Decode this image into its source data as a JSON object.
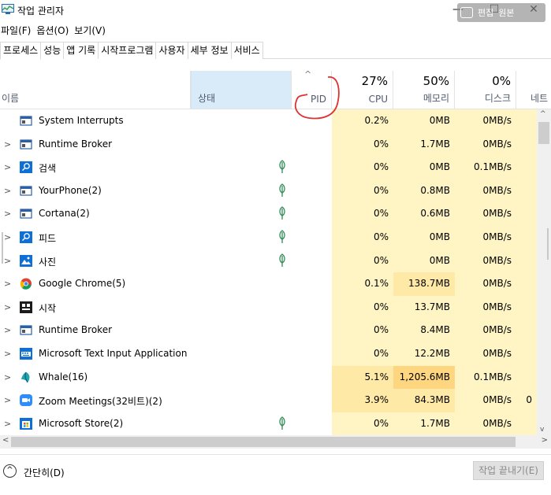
{
  "window": {
    "title": "작업 관리자"
  },
  "overlay": {
    "label_1": "편집",
    "label_2": "원본"
  },
  "menu": [
    "파일(F)",
    "옵션(O)",
    "보기(V)"
  ],
  "tabs": [
    "프로세스",
    "성능",
    "앱 기록",
    "시작프로그램",
    "사용자",
    "세부 정보",
    "서비스"
  ],
  "header": {
    "name": "이름",
    "status": "상태",
    "pid": "PID",
    "cpu": {
      "pct": "27%",
      "label": "CPU"
    },
    "memory": {
      "pct": "50%",
      "label": "메모리"
    },
    "disk": {
      "pct": "0%",
      "label": "디스크"
    },
    "network": {
      "label": "네트"
    }
  },
  "heat_colors": {
    "light": "#fff4c4",
    "medium": "#ffe9a6",
    "strong": "#ffd680"
  },
  "processes": [
    {
      "name": "System Interrupts",
      "icon": "window-icon",
      "expand": false,
      "leaf": false,
      "cpu": "0.2%",
      "mem": "0MB",
      "disk": "0MB/s",
      "net": ""
    },
    {
      "name": "Runtime Broker",
      "icon": "window-icon",
      "expand": true,
      "leaf": false,
      "cpu": "0%",
      "mem": "1.7MB",
      "disk": "0MB/s",
      "net": ""
    },
    {
      "name": "검색",
      "icon": "search-icon",
      "expand": true,
      "leaf": true,
      "cpu": "0%",
      "mem": "0MB",
      "disk": "0.1MB/s",
      "net": ""
    },
    {
      "name": "YourPhone(2)",
      "icon": "window-icon",
      "expand": true,
      "leaf": true,
      "cpu": "0%",
      "mem": "0.8MB",
      "disk": "0MB/s",
      "net": ""
    },
    {
      "name": "Cortana(2)",
      "icon": "window-icon",
      "expand": true,
      "leaf": true,
      "cpu": "0%",
      "mem": "0.6MB",
      "disk": "0MB/s",
      "net": ""
    },
    {
      "name": "피드",
      "icon": "search-icon",
      "expand": true,
      "leaf": true,
      "cpu": "0%",
      "mem": "0MB",
      "disk": "0MB/s",
      "net": ""
    },
    {
      "name": "사진",
      "icon": "photo-icon",
      "expand": true,
      "leaf": true,
      "cpu": "0%",
      "mem": "0MB",
      "disk": "0MB/s",
      "net": ""
    },
    {
      "name": "Google Chrome(5)",
      "icon": "chrome-icon",
      "expand": true,
      "leaf": false,
      "cpu": "0.1%",
      "mem": "138.7MB",
      "disk": "0MB/s",
      "net": ""
    },
    {
      "name": "시작",
      "icon": "start-icon",
      "expand": true,
      "leaf": false,
      "cpu": "0%",
      "mem": "13.7MB",
      "disk": "0MB/s",
      "net": ""
    },
    {
      "name": "Runtime Broker",
      "icon": "window-icon",
      "expand": true,
      "leaf": false,
      "cpu": "0%",
      "mem": "8.4MB",
      "disk": "0MB/s",
      "net": ""
    },
    {
      "name": "Microsoft Text Input Application",
      "icon": "keyboard-icon",
      "expand": true,
      "leaf": false,
      "cpu": "0%",
      "mem": "12.2MB",
      "disk": "0MB/s",
      "net": ""
    },
    {
      "name": "Whale(16)",
      "icon": "whale-icon",
      "expand": true,
      "leaf": false,
      "cpu": "5.1%",
      "mem": "1,205.6MB",
      "disk": "0.1MB/s",
      "net": ""
    },
    {
      "name": "Zoom Meetings(32비트)(2)",
      "icon": "zoom-icon",
      "expand": true,
      "leaf": false,
      "cpu": "3.9%",
      "mem": "84.3MB",
      "disk": "0MB/s",
      "net": "0"
    },
    {
      "name": "Microsoft Store(2)",
      "icon": "store-icon",
      "expand": true,
      "leaf": true,
      "cpu": "0%",
      "mem": "1.7MB",
      "disk": "0MB/s",
      "net": ""
    }
  ],
  "footer": {
    "fewer_details": "간단히(D)",
    "end_task": "작업 끝내기(E)"
  }
}
